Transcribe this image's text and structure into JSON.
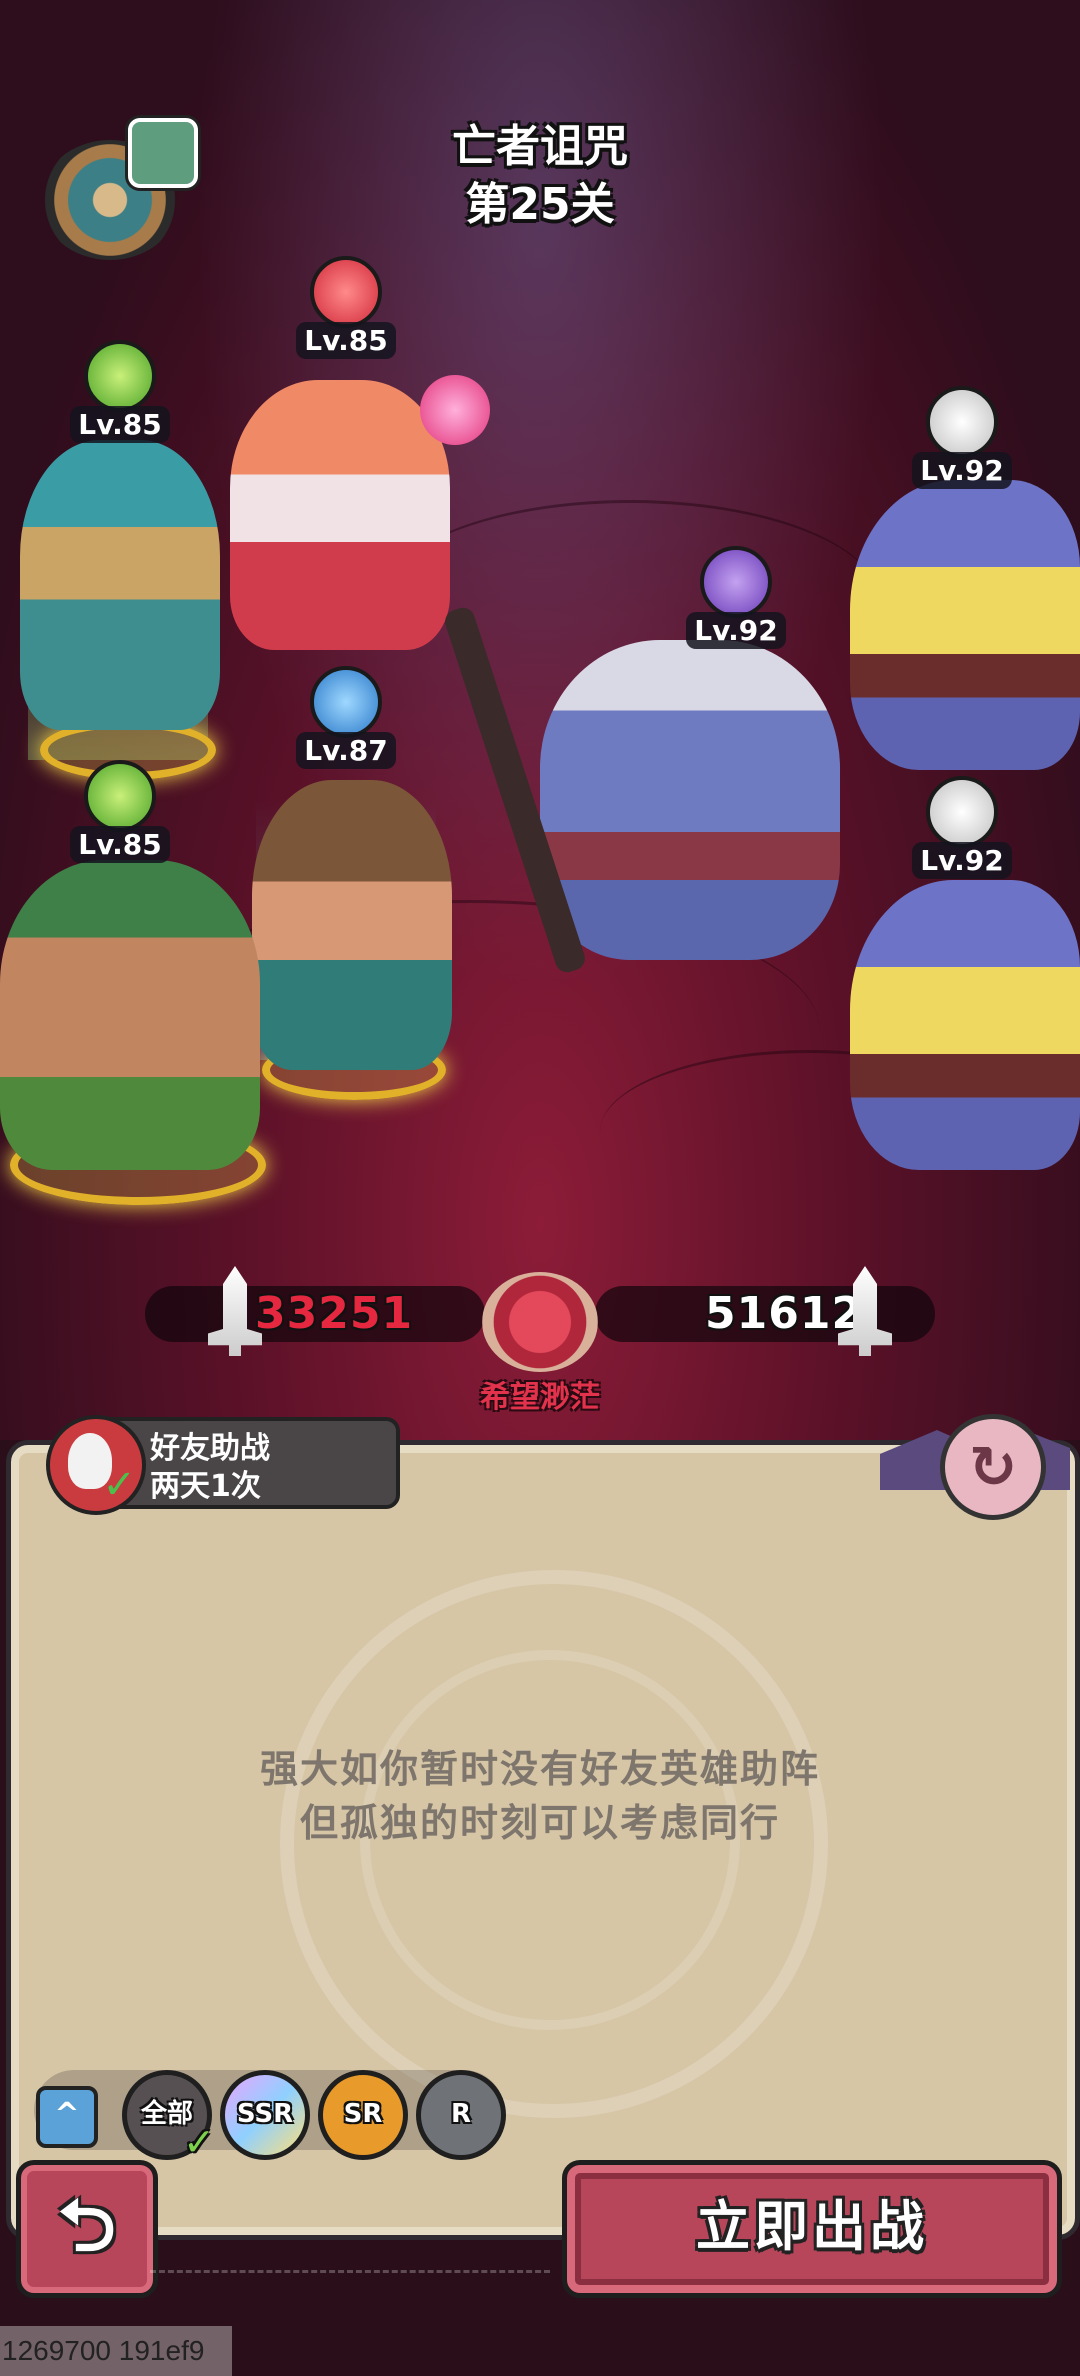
{
  "stage": {
    "line1": "亡者诅咒",
    "line2": "第25关"
  },
  "heroes": [
    {
      "name": "plant-siren",
      "level": "Lv.85",
      "element": "nature"
    },
    {
      "name": "flame-princess",
      "level": "Lv.85",
      "element": "fire"
    },
    {
      "name": "water-monk",
      "level": "Lv.87",
      "element": "water"
    },
    {
      "name": "tribal-warrior",
      "level": "Lv.85",
      "element": "nature"
    }
  ],
  "enemies": [
    {
      "name": "skull-ogre-top",
      "level": "Lv.92",
      "element": "skull"
    },
    {
      "name": "demon-shaman",
      "level": "Lv.92",
      "element": "dark"
    },
    {
      "name": "skull-ogre-bottom",
      "level": "Lv.92",
      "element": "skull"
    }
  ],
  "power": {
    "ally": "33251",
    "enemy": "51612",
    "verdict": "希望渺茫"
  },
  "helper": {
    "line1": "好友助战",
    "line2": "两天1次"
  },
  "message": {
    "line1": "强大如你暂时没有好友英雄助阵",
    "line2": "但孤独的时刻可以考虑同行"
  },
  "filters": {
    "all": "全部",
    "ssr": "SSR",
    "sr": "SR",
    "r": "R",
    "collapse": "^"
  },
  "buttons": {
    "back": "⮌",
    "start": "立即出战",
    "refresh": "↻"
  },
  "debug": "1269700 191ef9",
  "colors": {
    "ally_power": "#e5283f",
    "enemy_power": "#ffffff",
    "button": "#b8465b",
    "panel": "#d6c6a6"
  }
}
